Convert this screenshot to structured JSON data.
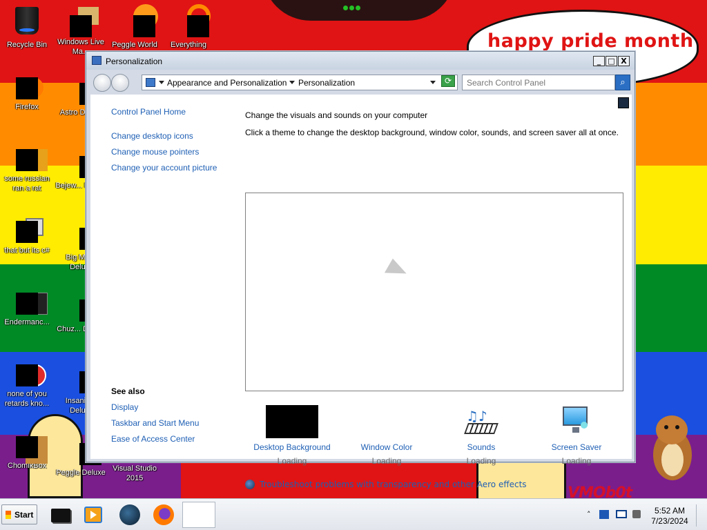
{
  "desktop": {
    "speech_text": "happy pride month",
    "watermark": "VMOb0t",
    "icons": [
      {
        "label": "Recycle Bin"
      },
      {
        "label": "Windows Live Ma..."
      },
      {
        "label": "Peggle World"
      },
      {
        "label": "Everything"
      },
      {
        "label": "Firefox"
      },
      {
        "label": "Astro Delu..."
      },
      {
        "label": "some russian ran a rat"
      },
      {
        "label": "Bejew... Delu..."
      },
      {
        "label": "that but its c#"
      },
      {
        "label": "Big Mo... Delu..."
      },
      {
        "label": "Endermanc..."
      },
      {
        "label": "Chuz... Delu..."
      },
      {
        "label": "none of you retards kno..."
      },
      {
        "label": "Insaniq... Delu..."
      },
      {
        "label": "ChomikBox"
      },
      {
        "label": "Peggle Deluxe"
      },
      {
        "label": "Visual Studio 2015"
      }
    ]
  },
  "window": {
    "title": "Personalization",
    "controls": {
      "minimize": "_",
      "maximize": "□",
      "close": "X"
    },
    "breadcrumb": [
      "Appearance and Personalization",
      "Personalization"
    ],
    "search_placeholder": "Search Control Panel",
    "left_pane": {
      "home_link": "Control Panel Home",
      "tasks": [
        "Change desktop icons",
        "Change mouse pointers",
        "Change your account picture"
      ],
      "see_also_heading": "See also",
      "see_also": [
        "Display",
        "Taskbar and Start Menu",
        "Ease of Access Center"
      ]
    },
    "main": {
      "heading": "Change the visuals and sounds on your computer",
      "description": "Click a theme to change the desktop background, window color, sounds, and screen saver all at once.",
      "tiles": [
        {
          "label": "Desktop Background",
          "status": "Loading"
        },
        {
          "label": "Window Color",
          "status": "Loading"
        },
        {
          "label": "Sounds",
          "status": "Loading"
        },
        {
          "label": "Screen Saver",
          "status": "Loading"
        }
      ],
      "troubleshoot_link": "Troubleshoot problems with transparency and other Aero effects"
    }
  },
  "taskbar": {
    "start_label": "Start",
    "time": "5:52 AM",
    "date": "7/23/2024"
  }
}
